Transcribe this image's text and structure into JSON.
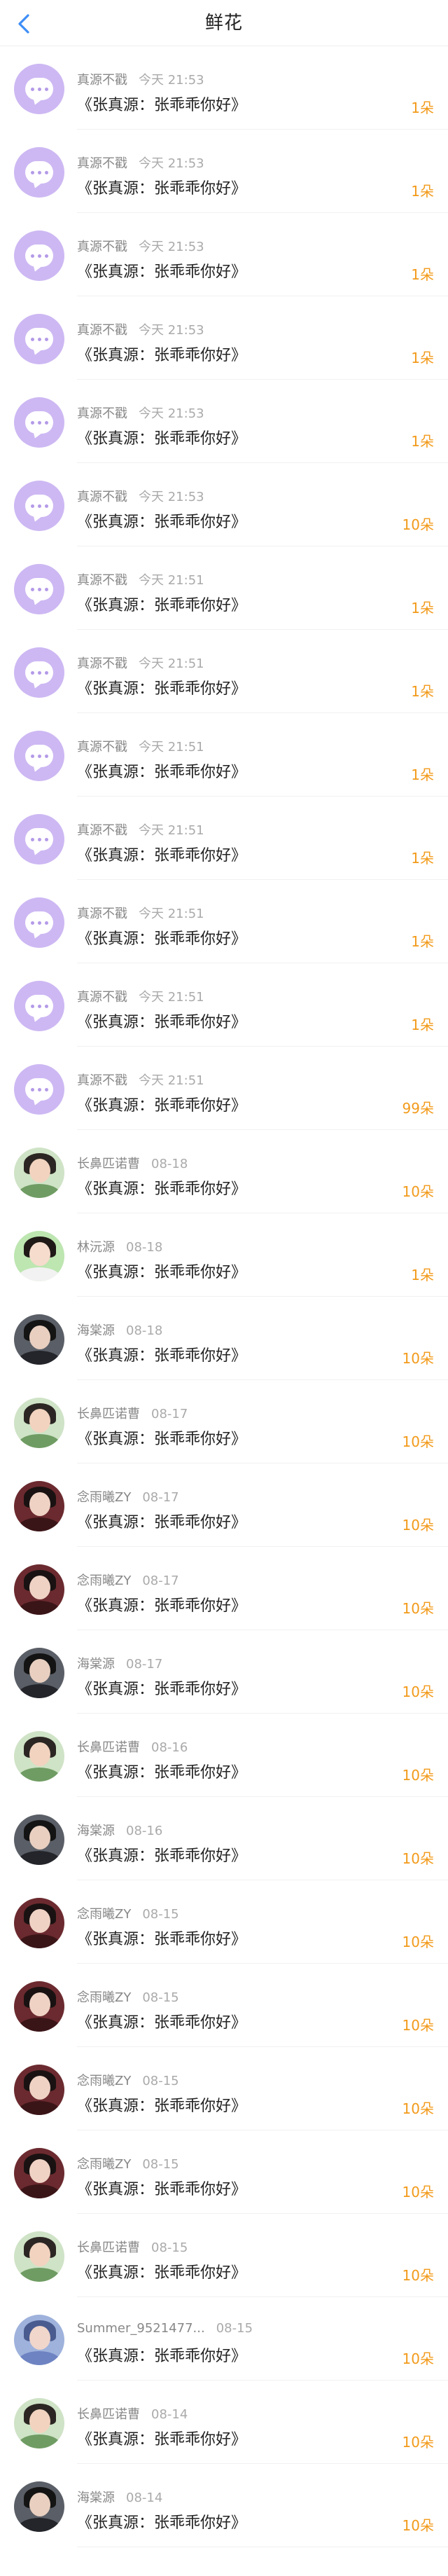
{
  "header": {
    "title": "鲜花",
    "back_icon": "chevron-left-icon"
  },
  "colors": {
    "accent_blue": "#3e8ef7",
    "count_orange": "#f29a1a",
    "default_avatar": "#cdb8f3"
  },
  "rows": [
    {
      "name": "真源不戳",
      "time": "今天 21:53",
      "message": "《张真源：张乖乖你好》",
      "count": "1朵",
      "avatar": "default"
    },
    {
      "name": "真源不戳",
      "time": "今天 21:53",
      "message": "《张真源：张乖乖你好》",
      "count": "1朵",
      "avatar": "default"
    },
    {
      "name": "真源不戳",
      "time": "今天 21:53",
      "message": "《张真源：张乖乖你好》",
      "count": "1朵",
      "avatar": "default"
    },
    {
      "name": "真源不戳",
      "time": "今天 21:53",
      "message": "《张真源：张乖乖你好》",
      "count": "1朵",
      "avatar": "default"
    },
    {
      "name": "真源不戳",
      "time": "今天 21:53",
      "message": "《张真源：张乖乖你好》",
      "count": "1朵",
      "avatar": "default"
    },
    {
      "name": "真源不戳",
      "time": "今天 21:53",
      "message": "《张真源：张乖乖你好》",
      "count": "10朵",
      "avatar": "default"
    },
    {
      "name": "真源不戳",
      "time": "今天 21:51",
      "message": "《张真源：张乖乖你好》",
      "count": "1朵",
      "avatar": "default"
    },
    {
      "name": "真源不戳",
      "time": "今天 21:51",
      "message": "《张真源：张乖乖你好》",
      "count": "1朵",
      "avatar": "default"
    },
    {
      "name": "真源不戳",
      "time": "今天 21:51",
      "message": "《张真源：张乖乖你好》",
      "count": "1朵",
      "avatar": "default"
    },
    {
      "name": "真源不戳",
      "time": "今天 21:51",
      "message": "《张真源：张乖乖你好》",
      "count": "1朵",
      "avatar": "default"
    },
    {
      "name": "真源不戳",
      "time": "今天 21:51",
      "message": "《张真源：张乖乖你好》",
      "count": "1朵",
      "avatar": "default"
    },
    {
      "name": "真源不戳",
      "time": "今天 21:51",
      "message": "《张真源：张乖乖你好》",
      "count": "1朵",
      "avatar": "default"
    },
    {
      "name": "真源不戳",
      "time": "今天 21:51",
      "message": "《张真源：张乖乖你好》",
      "count": "99朵",
      "avatar": "default"
    },
    {
      "name": "长鼻匹诺曹",
      "time": "08-18",
      "message": "《张真源：张乖乖你好》",
      "count": "10朵",
      "avatar": "green"
    },
    {
      "name": "林沅源",
      "time": "08-18",
      "message": "《张真源：张乖乖你好》",
      "count": "1朵",
      "avatar": "girl"
    },
    {
      "name": "海棠源",
      "time": "08-18",
      "message": "《张真源：张乖乖你好》",
      "count": "10朵",
      "avatar": "dark"
    },
    {
      "name": "长鼻匹诺曹",
      "time": "08-17",
      "message": "《张真源：张乖乖你好》",
      "count": "10朵",
      "avatar": "green"
    },
    {
      "name": "念雨曦ZY",
      "time": "08-17",
      "message": "《张真源：张乖乖你好》",
      "count": "10朵",
      "avatar": "maroon"
    },
    {
      "name": "念雨曦ZY",
      "time": "08-17",
      "message": "《张真源：张乖乖你好》",
      "count": "10朵",
      "avatar": "maroon"
    },
    {
      "name": "海棠源",
      "time": "08-17",
      "message": "《张真源：张乖乖你好》",
      "count": "10朵",
      "avatar": "dark"
    },
    {
      "name": "长鼻匹诺曹",
      "time": "08-16",
      "message": "《张真源：张乖乖你好》",
      "count": "10朵",
      "avatar": "green"
    },
    {
      "name": "海棠源",
      "time": "08-16",
      "message": "《张真源：张乖乖你好》",
      "count": "10朵",
      "avatar": "dark"
    },
    {
      "name": "念雨曦ZY",
      "time": "08-15",
      "message": "《张真源：张乖乖你好》",
      "count": "10朵",
      "avatar": "maroon"
    },
    {
      "name": "念雨曦ZY",
      "time": "08-15",
      "message": "《张真源：张乖乖你好》",
      "count": "10朵",
      "avatar": "maroon"
    },
    {
      "name": "念雨曦ZY",
      "time": "08-15",
      "message": "《张真源：张乖乖你好》",
      "count": "10朵",
      "avatar": "maroon"
    },
    {
      "name": "念雨曦ZY",
      "time": "08-15",
      "message": "《张真源：张乖乖你好》",
      "count": "10朵",
      "avatar": "maroon"
    },
    {
      "name": "长鼻匹诺曹",
      "time": "08-15",
      "message": "《张真源：张乖乖你好》",
      "count": "10朵",
      "avatar": "green"
    },
    {
      "name": "Summer_9521477...",
      "time": "08-15",
      "message": "《张真源：张乖乖你好》",
      "count": "10朵",
      "avatar": "blue"
    },
    {
      "name": "长鼻匹诺曹",
      "time": "08-14",
      "message": "《张真源：张乖乖你好》",
      "count": "10朵",
      "avatar": "green"
    },
    {
      "name": "海棠源",
      "time": "08-14",
      "message": "《张真源：张乖乖你好》",
      "count": "10朵",
      "avatar": "dark"
    }
  ]
}
